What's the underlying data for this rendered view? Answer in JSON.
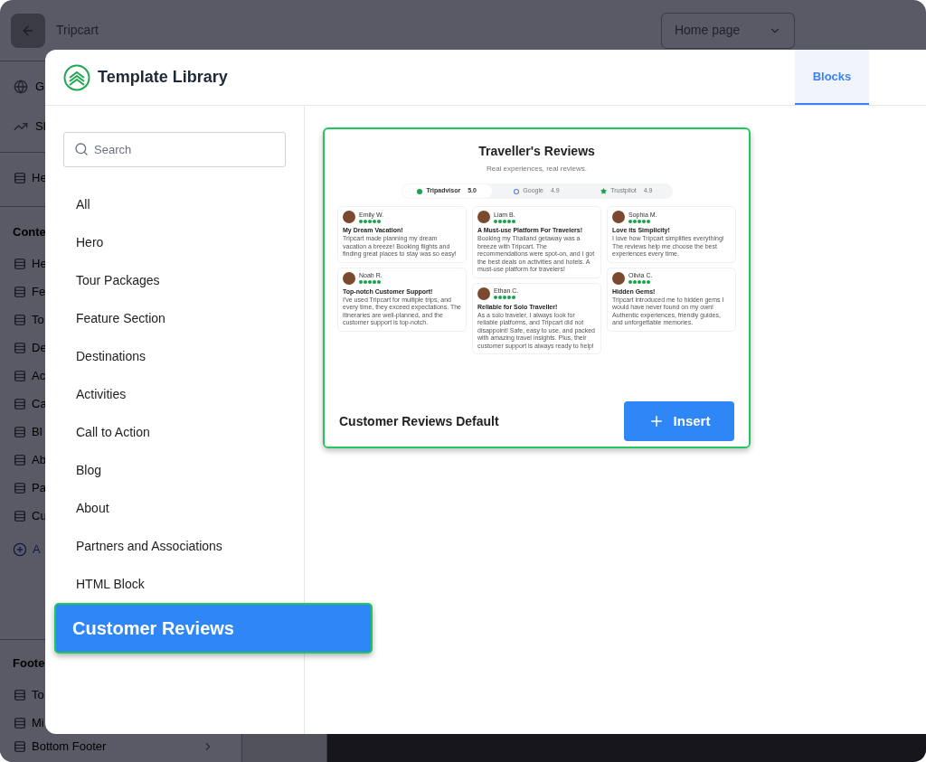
{
  "background": {
    "app_name": "Tripcart",
    "page_select": "Home page",
    "sidebar_top": [
      {
        "kind": "globe",
        "label": "G"
      },
      {
        "kind": "chart",
        "label": "Sl"
      }
    ],
    "header_item": "He",
    "content_heading": "Conte",
    "content_items": [
      "He",
      "Fe",
      "To",
      "De",
      "Ac",
      "Ca",
      "Bl",
      "Ab",
      "Pa",
      "Cu"
    ],
    "add_item": "A",
    "footer_heading": "Foote",
    "footer_items": [
      "To",
      "Mi",
      "Bottom Footer"
    ]
  },
  "modal": {
    "title": "Template Library",
    "tabs": [
      {
        "label": "Blocks",
        "selected": true
      }
    ],
    "search": {
      "placeholder": "Search"
    },
    "categories": [
      {
        "label": "All",
        "selected": false
      },
      {
        "label": "Hero",
        "selected": false
      },
      {
        "label": "Tour Packages",
        "selected": false
      },
      {
        "label": "Feature Section",
        "selected": false
      },
      {
        "label": "Destinations",
        "selected": false
      },
      {
        "label": "Activities",
        "selected": false
      },
      {
        "label": "Call to Action",
        "selected": false
      },
      {
        "label": "Blog",
        "selected": false
      },
      {
        "label": "About",
        "selected": false
      },
      {
        "label": "Partners and Associations",
        "selected": false
      },
      {
        "label": "HTML Block",
        "selected": false
      },
      {
        "label": "Customer Reviews",
        "selected": true
      }
    ],
    "template": {
      "name": "Customer Reviews Default",
      "insert_label": "Insert",
      "preview": {
        "title": "Traveller's Reviews",
        "subtitle": "Real experiences, real reviews.",
        "sources": [
          {
            "kind": "tripadvisor",
            "name": "Tripadvisor",
            "rating": "5.0",
            "selected": true
          },
          {
            "kind": "google",
            "name": "Google",
            "rating": "4.9",
            "selected": false
          },
          {
            "kind": "trustpilot",
            "name": "Trustpilot",
            "rating": "4.9",
            "selected": false
          }
        ],
        "reviews": [
          {
            "name": "Emily W.",
            "stars": 5,
            "headline": "My Dream Vacation!",
            "text": "Tripcart made planning my dream vacation a breeze! Booking flights and finding great places to stay was so easy!"
          },
          {
            "name": "Liam B.",
            "stars": 5,
            "headline": "A Must-use Platform For Travelers!",
            "text": "Booking my Thailand getaway was a breeze with Tripcart. The recommendations were spot-on, and I got the best deals on activities and hotels. A must-use platform for travelers!"
          },
          {
            "name": "Sophia M.",
            "stars": 5,
            "headline": "Love its Simplicity!",
            "text": "I love how Tripcart simplifies everything! The reviews help me choose the best experiences every time."
          },
          {
            "name": "Noah R.",
            "stars": 5,
            "headline": "Top-notch Customer Support!",
            "text": "I've used Tripcart for multiple trips, and every time, they exceed expectations. The itineraries are well-planned, and the customer support is top-notch."
          },
          {
            "name": "Ethan C.",
            "stars": 5,
            "headline": "Reliable for Solo Traveller!",
            "text": "As a solo traveler, I always look for reliable platforms, and Tripcart did not disappoint! Safe, easy to use, and packed with amazing travel insights. Plus, their customer support is always ready to help!"
          },
          {
            "name": "Olivia C.",
            "stars": 5,
            "headline": "Hidden Gems!",
            "text": "Tripcart introduced me to hidden gems I would have never found on my own! Authentic experiences, friendly guides, and unforgettable memories."
          }
        ]
      }
    }
  }
}
